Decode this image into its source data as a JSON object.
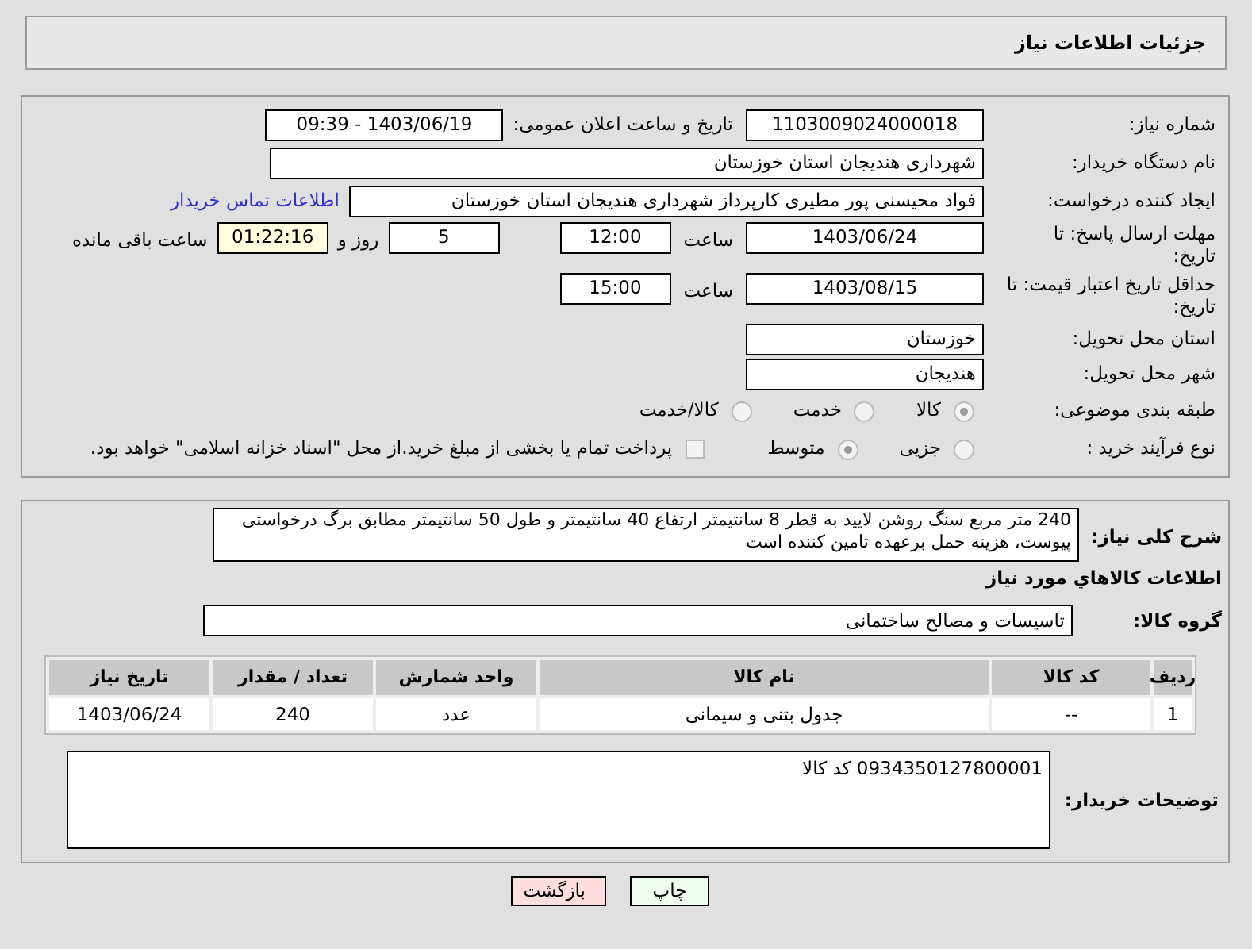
{
  "header": {
    "title": "جزئیات اطلاعات نیاز"
  },
  "need_number": {
    "label": "شماره نیاز:",
    "value": "1103009024000018"
  },
  "announce": {
    "label": "تاریخ و ساعت اعلان عمومی:",
    "value": "1403/06/19 - 09:39"
  },
  "buyer_org": {
    "label": "نام دستگاه خریدار:",
    "value": "شهرداری هندیجان استان خوزستان"
  },
  "requester": {
    "label": "ایجاد کننده درخواست:",
    "value": "فواد محیسنی پور مطیری کارپرداز شهرداری هندیجان استان خوزستان",
    "link": "اطلاعات تماس خریدار"
  },
  "reply_deadline": {
    "label": "مهلت ارسال پاسخ: تا تاریخ:",
    "date": "1403/06/24",
    "time_label": "ساعت",
    "time": "12:00",
    "days": "5",
    "days_label": "روز و",
    "remaining": "01:22:16",
    "remaining_label": "ساعت باقی مانده"
  },
  "price_validity": {
    "label": "حداقل تاریخ اعتبار قیمت: تا تاریخ:",
    "date": "1403/08/15",
    "time_label": "ساعت",
    "time": "15:00"
  },
  "province": {
    "label": "استان محل تحویل:",
    "value": "خوزستان"
  },
  "city": {
    "label": "شهر محل تحویل:",
    "value": "هندیجان"
  },
  "category": {
    "label": "طبقه بندی موضوعی:",
    "options": [
      {
        "label": "کالا",
        "selected": true
      },
      {
        "label": "خدمت",
        "selected": false
      },
      {
        "label": "کالا/خدمت",
        "selected": false
      }
    ]
  },
  "purchase_process": {
    "label": "نوع فرآیند خرید :",
    "options": [
      {
        "label": "جزیی",
        "selected": false
      },
      {
        "label": "متوسط",
        "selected": true
      }
    ],
    "payment": {
      "label": "پرداخت تمام یا بخشی از مبلغ خرید.از محل \"اسناد خزانه اسلامی\" خواهد بود.",
      "checked": false
    }
  },
  "description": {
    "label": "شرح کلی نیاز:",
    "value": "240 متر مربع سنگ روشن لایید به قطر 8 سانتیمتر ارتفاع 40 سانتیمتر و طول 50 سانتیمتر مطابق برگ درخواستی پیوست، هزینه حمل برعهده تامین کننده است"
  },
  "items_title": "اطلاعات کالاهاي مورد نياز",
  "goods_group": {
    "label": "گروه کالا:",
    "value": "تاسیسات و مصالح ساختمانی"
  },
  "table": {
    "columns": [
      "ردیف",
      "کد کالا",
      "نام کالا",
      "واحد شمارش",
      "تعداد / مقدار",
      "تاریخ نیاز"
    ],
    "rows": [
      [
        "1",
        "--",
        "جدول بتنی و سیمانی",
        "عدد",
        "240",
        "1403/06/24"
      ]
    ]
  },
  "buyer_notes": {
    "label": "توضیحات خریدار:",
    "value": "0934350127800001 کد کالا"
  },
  "buttons": [
    {
      "label": "چاپ",
      "kind": "print"
    },
    {
      "label": "بازگشت",
      "kind": "back"
    }
  ]
}
